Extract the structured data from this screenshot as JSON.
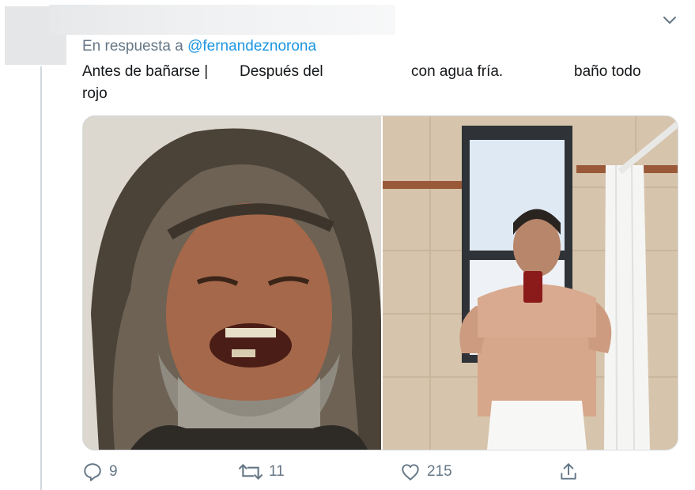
{
  "reply": {
    "prefix": "En respuesta a",
    "handle": "@fernandeznorona"
  },
  "tweet": {
    "seg1": "Antes de bañarse |",
    "seg2": "Después del",
    "seg3": "con agua fría.",
    "seg4": "baño todo",
    "seg5": "rojo"
  },
  "media": {
    "left_image": "bearded-man-laughing-photo",
    "right_image": "man-bathroom-mirror-selfie-photo"
  },
  "actions": {
    "replies": "9",
    "retweets": "11",
    "likes": "215"
  },
  "colors": {
    "secondary_text": "#657786",
    "link": "#1b95e0",
    "thread_line": "#cfd9de"
  }
}
